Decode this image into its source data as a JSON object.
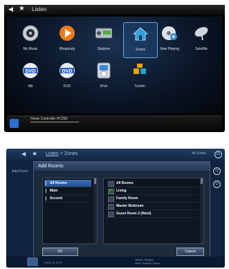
{
  "colors": {
    "accent": "#6aa9e0",
    "check": "#6cf04a"
  },
  "top_screen": {
    "title": "Listen",
    "tiles": [
      {
        "label": "My Music",
        "icon": "music-disc-icon"
      },
      {
        "label": "Rhapsody",
        "icon": "rhapsody-icon"
      },
      {
        "label": "Stations",
        "icon": "radio-icon"
      },
      {
        "label": "Zones",
        "icon": "house-icon",
        "selected": true
      },
      {
        "label": "Now Playing",
        "icon": "now-playing-icon"
      },
      {
        "label": "Satellite",
        "icon": "satellite-icon"
      },
      {
        "label": "Wii",
        "icon": "dvd-wii-icon"
      },
      {
        "label": "DVD",
        "icon": "dvd-icon"
      },
      {
        "label": "iPod",
        "icon": "ipod-icon"
      },
      {
        "label": "TuneIn",
        "icon": "tunein-icon"
      }
    ],
    "status_text": "Home Controller HC250"
  },
  "bottom_screen": {
    "breadcrumb_root": "Listen",
    "breadcrumb_sep": ">",
    "breadcrumb_current": "Zones",
    "right_label": "All Zones",
    "side_label": "Add Room",
    "dialog": {
      "title": "Add Rooms",
      "left_items": [
        {
          "label": "All Rooms",
          "selected": true
        },
        {
          "label": "Main"
        },
        {
          "label": "Second"
        }
      ],
      "right_items": [
        {
          "label": "All Rooms",
          "checked": false
        },
        {
          "label": "Living",
          "checked": true
        },
        {
          "label": "Family Room",
          "checked": false
        },
        {
          "label": "Master Bedroom",
          "checked": false
        },
        {
          "label": "Guest Room 2 (West)",
          "checked": false
        }
      ],
      "ok_label": "OK",
      "cancel_label": "Cancel"
    },
    "track_text": "Track: 14 of 19",
    "album_line1": "Album: Singles",
    "album_line2": "Next: Hand In Glove"
  }
}
